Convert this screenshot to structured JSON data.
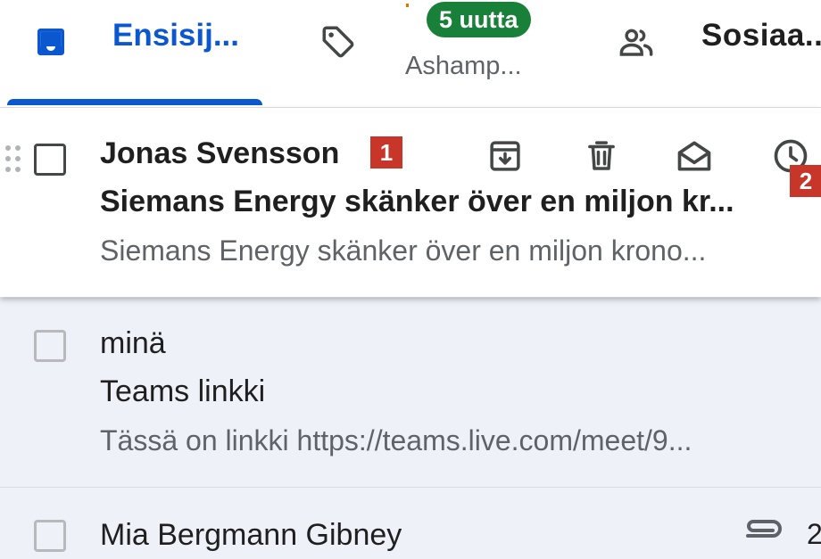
{
  "tabs": {
    "primary": {
      "label": "Ensisij...",
      "icon": "inbox-icon"
    },
    "promotions": {
      "badge": "5 uutta",
      "sublabel": "Ashamp...",
      "icon": "tag-icon"
    },
    "social": {
      "label": "Sosiaa..",
      "icon": "people-icon"
    }
  },
  "colors": {
    "accent": "#0b57d0",
    "badge": "#188038",
    "callout": "#c8362a",
    "unread_row_bg": "#ffffff",
    "read_row_bg": "#eef1f8"
  },
  "emails": [
    {
      "sender": "Jonas Svensson",
      "subject": "Siemans Energy skänker över en miljon kr...",
      "snippet": "Siemans Energy skänker över en miljon krono...",
      "unread": true,
      "hover_actions": [
        "archive-icon",
        "delete-icon",
        "mark-read-icon",
        "snooze-icon"
      ]
    },
    {
      "sender": "minä",
      "subject": "Teams linkki",
      "snippet": "Tässä on linkki https://teams.live.com/meet/9...",
      "unread": false
    },
    {
      "sender": "Mia Bergmann Gibney",
      "has_attachment": true,
      "date_partial": "2",
      "unread": false
    }
  ],
  "callouts": {
    "first": "1",
    "second": "2"
  }
}
